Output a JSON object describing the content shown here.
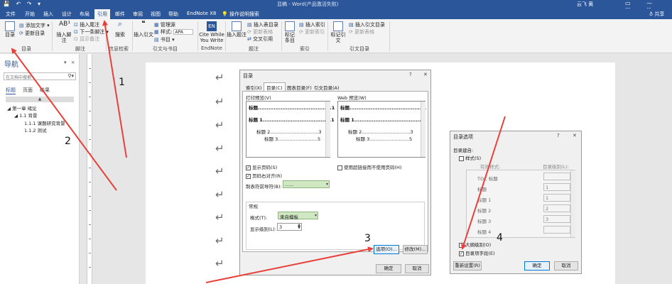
{
  "titlebar": {
    "quick_access": "💾 ↶ ↷ ▾",
    "doc_title": "显稿 - Word(产品激活失败)",
    "user": "云飞 黄",
    "window_buttons": "▭ — ▢ ✕"
  },
  "menu": {
    "tabs": [
      "文件",
      "开始",
      "插入",
      "设计",
      "布局",
      "引用",
      "邮件",
      "审阅",
      "视图",
      "帮助",
      "EndNote X8"
    ],
    "tell_me": "💡 操作说明搜索",
    "share": "♁ 共享"
  },
  "ribbon": {
    "toc_group": {
      "toc_button": "目录",
      "add_text": "添加文字 ▾",
      "update_toc": "更新目录",
      "label": "目录"
    },
    "footnote_group": {
      "insert_footnote": "插入脚注",
      "insert_endnote": "插入尾注",
      "next_footnote": "下一条脚注 ▾",
      "show_notes": "显示备注",
      "label": "脚注"
    },
    "research_group": {
      "search": "搜索",
      "label": "信息检索"
    },
    "citations_group": {
      "insert_citation": "插入引文",
      "manage_sources": "管理源",
      "style_label": "样式:",
      "style_value": "APA",
      "bibliography": "书目 ▾",
      "label": "引文与书目"
    },
    "endnote_group": {
      "cite_while_you_write": "Cite While You Write",
      "label": "EndNote"
    },
    "captions_group": {
      "insert_caption": "插入题注",
      "insert_table_of_figures": "插入表目录",
      "update_table": "更新表格",
      "cross_reference": "交叉引用",
      "label": "题注"
    },
    "index_group": {
      "mark_entry": "标记条目",
      "insert_index": "插入索引",
      "update_index": "更新索引",
      "label": "索引"
    },
    "toa_group": {
      "mark_citation": "标记引文",
      "insert_toa": "插入引文目录",
      "update_toa": "更新表格",
      "label": "引文目录"
    }
  },
  "navpane": {
    "title": "导航",
    "tools": "▾ ×",
    "search_placeholder": "在文档中搜索",
    "tabs": [
      "标题",
      "页面",
      "结果"
    ],
    "collapse": "▲",
    "items": [
      "◢ 第一章 绪论",
      "◢ 1.1 背景",
      "1.1.1 课题研究背景",
      "1.1.2 测试"
    ]
  },
  "doc": {
    "para_mark": "↵"
  },
  "toc_dialog": {
    "title": "目录",
    "help": "?",
    "close": "✕",
    "tabs": [
      "索引(X)",
      "目录(C)",
      "图表目录(F)",
      "引文目录(A)"
    ],
    "print_preview_label": "打印预览(V)",
    "web_preview_label": "Web 预览(W)",
    "print_preview": [
      {
        "text": "标题..........................................1",
        "bold": true
      },
      {
        "text": "标题 1.......................................1",
        "bold": true
      },
      {
        "text": "标题 2.................................3",
        "bold": false
      },
      {
        "text": "标题 3...........................5",
        "bold": false
      }
    ],
    "web_preview": [
      {
        "text": "标题..........................................1",
        "bold": true
      },
      {
        "text": "标题 1.......................................1",
        "bold": true
      },
      {
        "text": "标题 2.................................3",
        "bold": false
      },
      {
        "text": "标题 3...........................5",
        "bold": false
      }
    ],
    "show_page_numbers": "显示页码(S)",
    "right_align": "页码右对齐(R)",
    "tab_leader_label": "制表符前导符(B):",
    "tab_leader_value": "......",
    "use_hyperlinks": "使用超链接而不使用页码(H)",
    "general_label": "常规",
    "formats_label": "格式(T):",
    "formats_value": "来自模板",
    "show_levels_label": "显示级别(L):",
    "show_levels_value": "3",
    "options_button": "选项(O)...",
    "modify_button": "修改(M)...",
    "ok_button": "确定",
    "cancel_button": "取消"
  },
  "options_dialog": {
    "title": "目录选项",
    "help": "?",
    "close": "✕",
    "build_from": "目录建自:",
    "styles_checkbox": "样式(S)",
    "available_styles": "有效样式:",
    "toc_level": "目录级别(L):",
    "styles": [
      {
        "name": "TOC 标题",
        "level": ""
      },
      {
        "name": "标题",
        "level": "1"
      },
      {
        "name": "标题 1",
        "level": "1"
      },
      {
        "name": "标题 2",
        "level": "2"
      },
      {
        "name": "标题 3",
        "level": "3"
      },
      {
        "name": "标题 4",
        "level": ""
      }
    ],
    "outline_levels": "大纲级别(O)",
    "toc_entry_fields": "目录项字段(E)",
    "reset_button": "重新设置(R)",
    "ok_button": "确定",
    "cancel_button": "取消"
  },
  "annotations": {
    "labels": [
      "1",
      "2",
      "3",
      "4"
    ],
    "arrow_color": "#e8403a"
  }
}
